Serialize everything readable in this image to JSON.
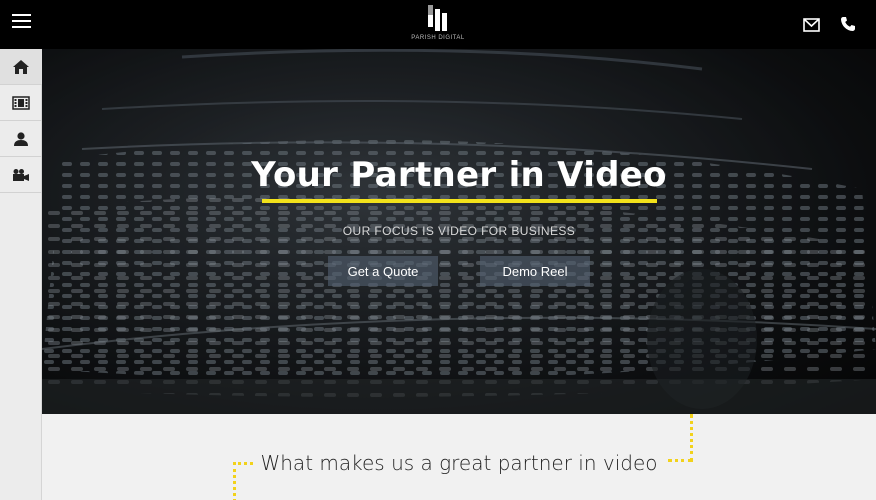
{
  "brand": {
    "name": "PARISH DIGITAL"
  },
  "hero": {
    "title": "Your Partner in Video",
    "subtitle": "OUR FOCUS IS VIDEO FOR BUSINESS",
    "buttons": {
      "quote": "Get a Quote",
      "demo": "Demo Reel"
    }
  },
  "section": {
    "heading": "What makes us a great partner in video"
  },
  "colors": {
    "accent": "#f2e21b",
    "topbar": "#000000",
    "sidebar": "#ececec",
    "button": "#526070"
  },
  "icons": {
    "menu": "hamburger-menu-icon",
    "mail": "envelope-icon",
    "phone": "phone-icon",
    "sidebar": [
      "home-icon",
      "film-icon",
      "person-icon",
      "video-camera-icon"
    ]
  }
}
